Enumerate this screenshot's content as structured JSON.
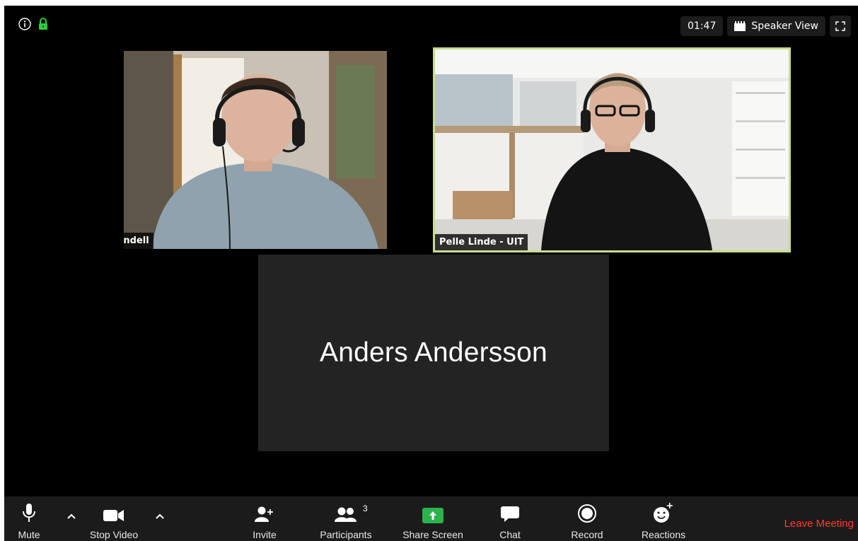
{
  "top_bar": {
    "timer": "01:47",
    "view_label": "Speaker View"
  },
  "participants": {
    "emil": {
      "name": "Emil Lundell"
    },
    "pelle": {
      "name": "Pelle Linde - UIT"
    },
    "anders": {
      "name": "Anders Andersson"
    }
  },
  "toolbar": {
    "mute": "Mute",
    "stop_video": "Stop Video",
    "invite": "Invite",
    "participants": "Participants",
    "participants_count": "3",
    "share_screen": "Share Screen",
    "chat": "Chat",
    "record": "Record",
    "reactions": "Reactions",
    "leave": "Leave Meeting"
  },
  "colors": {
    "active_speaker_border": "#c8dc8c",
    "share_screen_green": "#2bb24c",
    "leave_red": "#ff3b30",
    "lock_green": "#2ecc40"
  }
}
